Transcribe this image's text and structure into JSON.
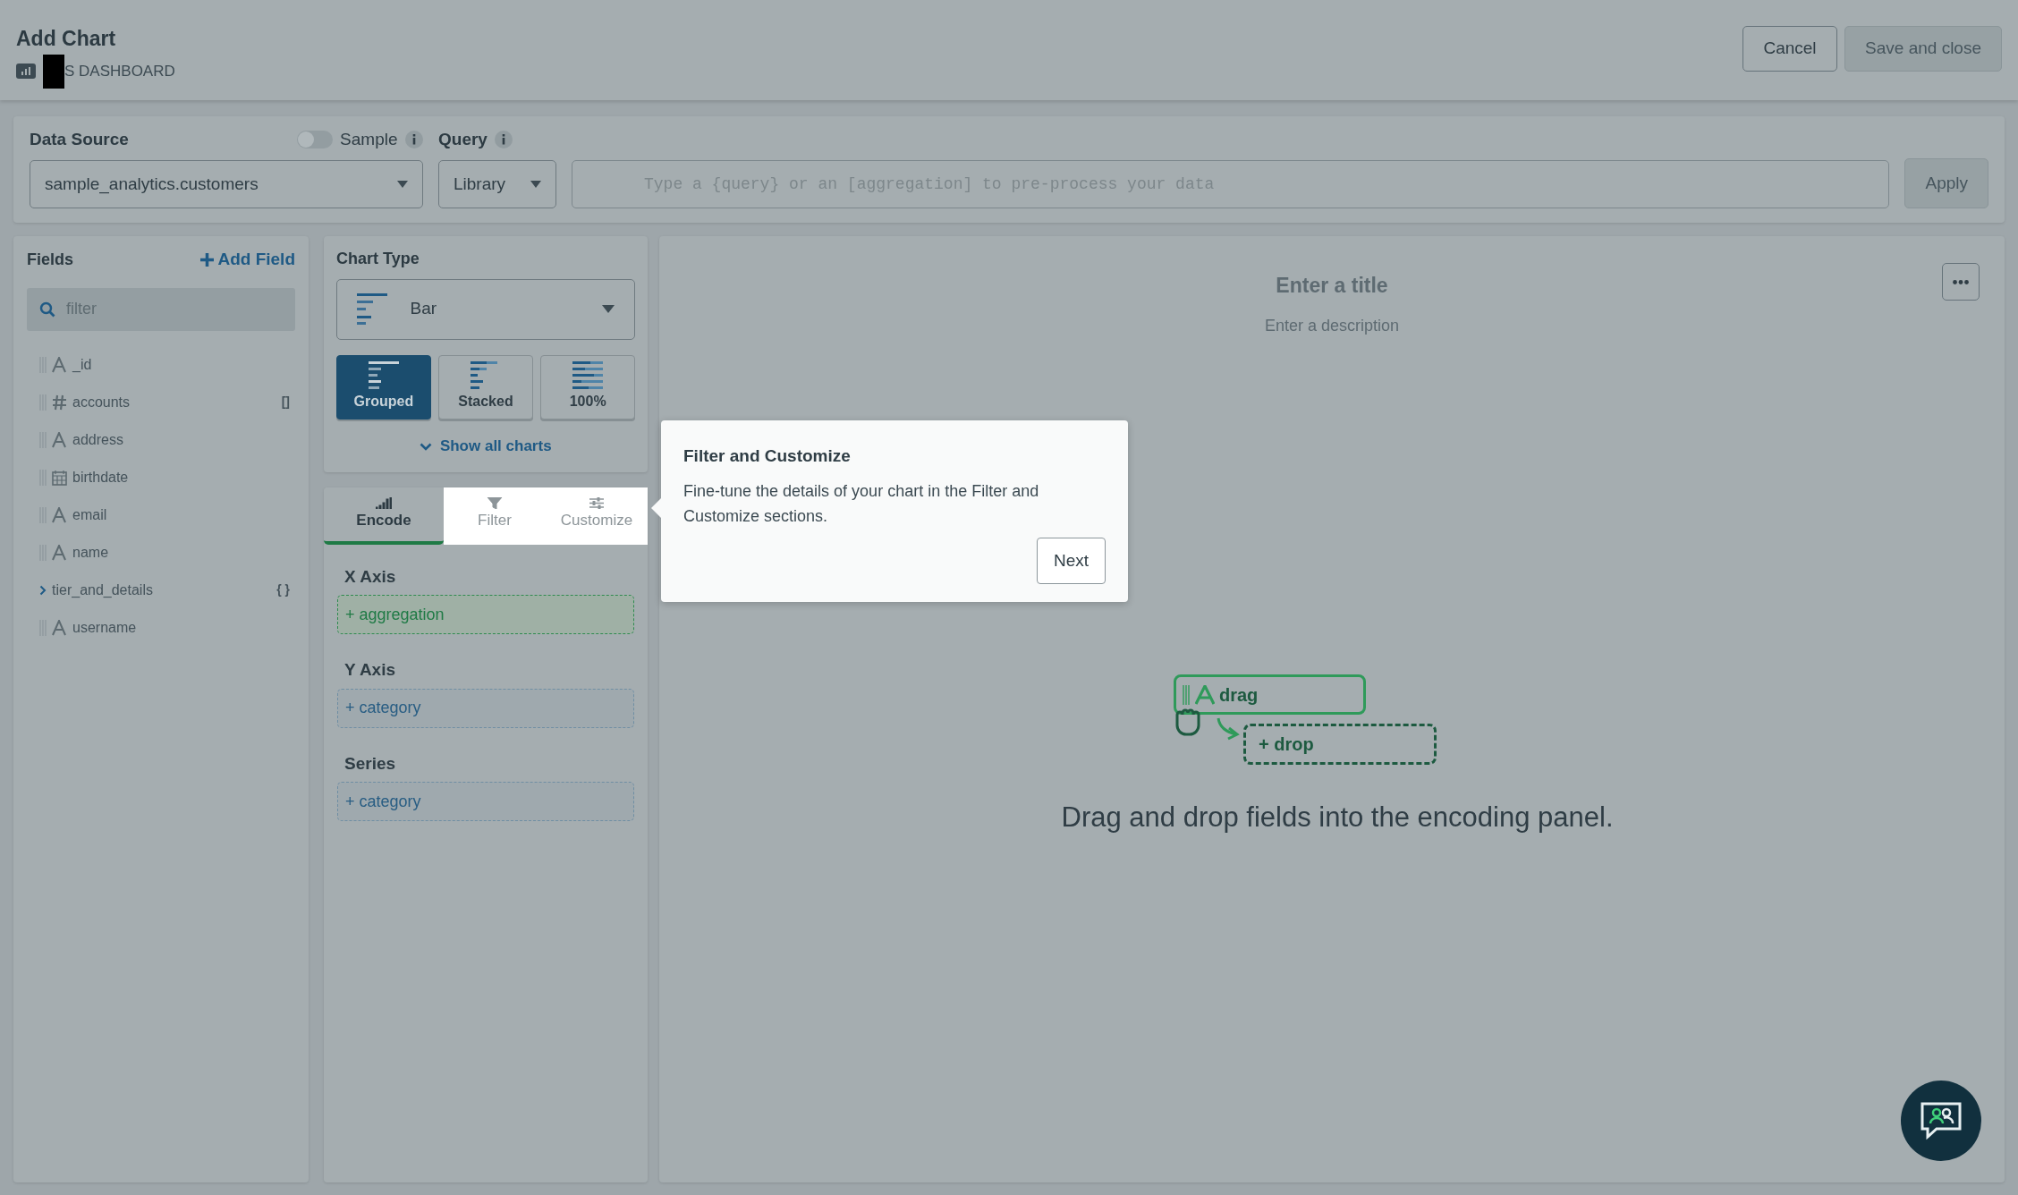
{
  "header": {
    "title": "Add Chart",
    "breadcrumb": "S DASHBOARD"
  },
  "actions": [
    {
      "label": "Cancel",
      "kind": "secondary"
    },
    {
      "label": "Save and close",
      "kind": "primary"
    }
  ],
  "data_source": {
    "label": "Data Source",
    "value": "sample_analytics.customers",
    "sample": {
      "label": "Sample",
      "on": false
    }
  },
  "query": {
    "label": "Query",
    "mode": "Library",
    "placeholder": "Type a {query} or an [aggregation] to pre-process your data",
    "apply": "Apply"
  },
  "fields": {
    "title": "Fields",
    "add": "Add Field",
    "search_placeholder": "filter",
    "items": [
      {
        "name": "_id",
        "kind": "string"
      },
      {
        "name": "accounts",
        "kind": "number",
        "suffix": "[]"
      },
      {
        "name": "address",
        "kind": "string"
      },
      {
        "name": "birthdate",
        "kind": "date"
      },
      {
        "name": "email",
        "kind": "string"
      },
      {
        "name": "name",
        "kind": "string"
      },
      {
        "name": "tier_and_details",
        "kind": "object",
        "suffix": "{ }"
      },
      {
        "name": "username",
        "kind": "string"
      }
    ]
  },
  "chart_type": {
    "title": "Chart Type",
    "value": "Bar",
    "variants": [
      {
        "label": "Grouped",
        "selected": true
      },
      {
        "label": "Stacked",
        "selected": false
      },
      {
        "label": "100%",
        "selected": false
      }
    ],
    "show_all": "Show all charts"
  },
  "tabs": [
    {
      "label": "Encode",
      "selected": true,
      "highlighted": false
    },
    {
      "label": "Filter",
      "selected": false,
      "highlighted": true
    },
    {
      "label": "Customize",
      "selected": false,
      "highlighted": true
    }
  ],
  "encodings": [
    {
      "label": "X Axis",
      "slot": "+ aggregation",
      "kind": "aggregation"
    },
    {
      "label": "Y Axis",
      "slot": "+ category",
      "kind": "category"
    },
    {
      "label": "Series",
      "slot": "+ category",
      "kind": "category"
    }
  ],
  "chart": {
    "title_placeholder": "Enter a title",
    "description_placeholder": "Enter a description",
    "drag": "drag",
    "drop": "+ drop",
    "hint": "Drag and drop fields into the encoding panel."
  },
  "tour": {
    "title": "Filter and Customize",
    "body": "Fine-tune the details of your chart in the Filter and Customize sections.",
    "next": "Next"
  }
}
